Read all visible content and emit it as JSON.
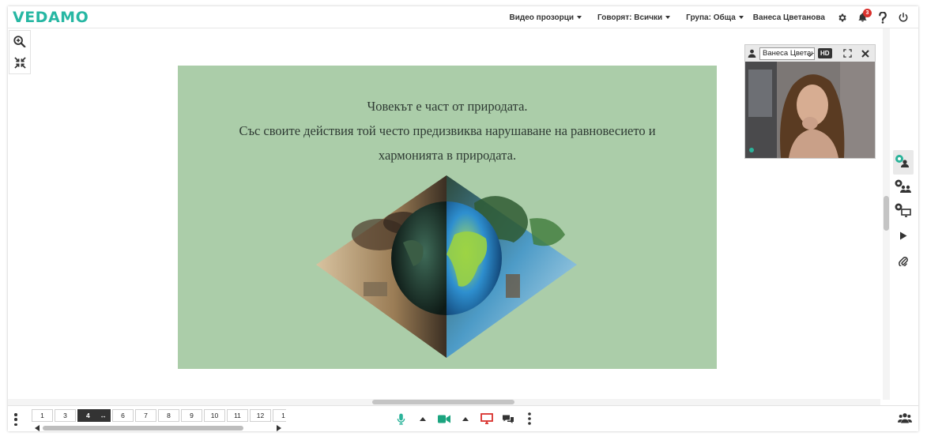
{
  "app": {
    "logo": "VEDAMO"
  },
  "header": {
    "video_windows": "Видео прозорци",
    "speaking": "Говорят: Всички",
    "group": "Група: Обща",
    "user": "Ванеса Цветанова",
    "notifications_count": "3"
  },
  "slide": {
    "line1": "Човекът е част от природата.",
    "line2": "Със своите действия той често предизвиква нарушаване на равновесието и",
    "line3": "хармонията в природата."
  },
  "video": {
    "participant": "Ванеса Цветанова",
    "hd": "HD"
  },
  "footer": {
    "pages": [
      "1",
      "3",
      "4",
      "6",
      "7",
      "8",
      "9",
      "10",
      "11",
      "12",
      "1"
    ],
    "active_page": "4",
    "active_suffix": "↔"
  },
  "colors": {
    "brand": "#27b7a3",
    "slide_bg": "#abcda9",
    "mic": "#2bb39a",
    "camera": "#1ba47f",
    "screen_share": "#d9302c",
    "badge": "#d9302c"
  }
}
